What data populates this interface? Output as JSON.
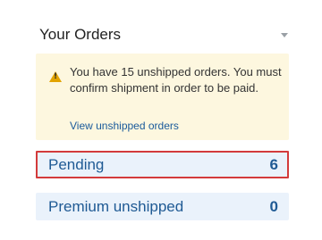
{
  "widget": {
    "title": "Your Orders",
    "menu_icon": "chevron-down-icon"
  },
  "alert": {
    "icon": "warning-icon",
    "message": "You have 15 unshipped orders. You must confirm shipment in order to be paid.",
    "link_label": "View unshipped orders"
  },
  "rows": [
    {
      "label": "Pending",
      "count": "6"
    },
    {
      "label": "Premium unshipped",
      "count": "0"
    }
  ],
  "colors": {
    "alert_bg": "#fdf7df",
    "row_bg": "#eaf2fb",
    "highlight_border": "#d33b3b",
    "link": "#1a5a9b",
    "row_text": "#1f5a94"
  }
}
